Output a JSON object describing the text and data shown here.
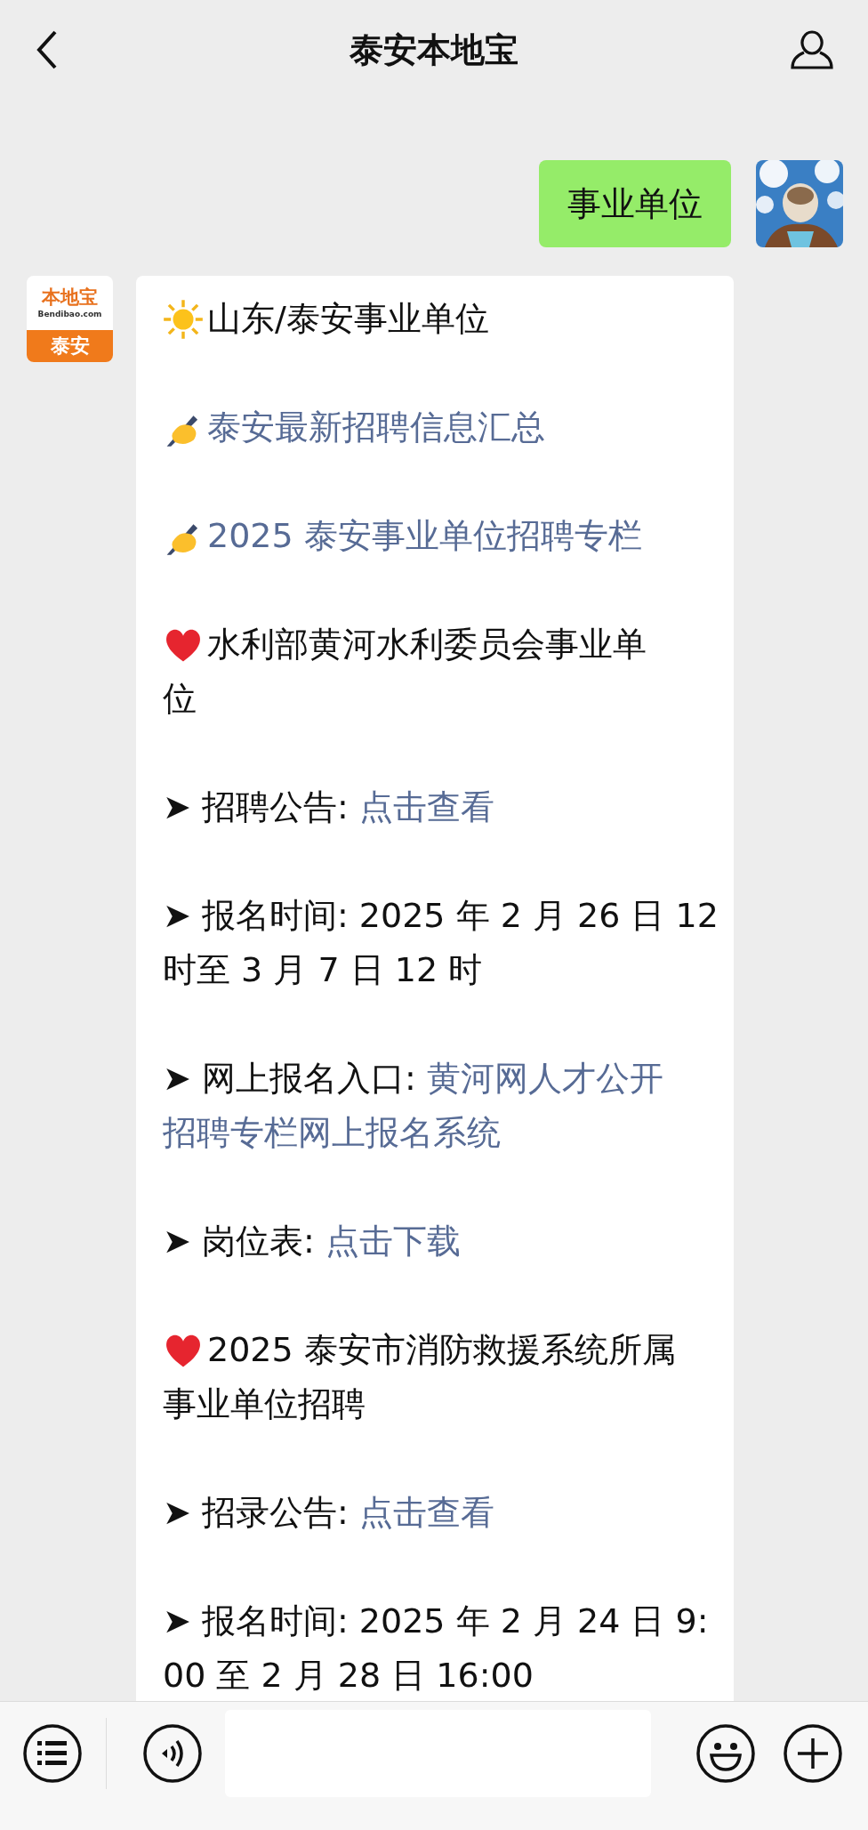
{
  "header": {
    "title": "泰安本地宝"
  },
  "sent": {
    "text": "事业单位"
  },
  "official": {
    "logo": {
      "top": "本地宝",
      "domain": "Bendibao.com",
      "city": "泰安"
    }
  },
  "message": {
    "paragraphs": [
      {
        "kind": "sun",
        "lines": [
          [
            {
              "text": "山东/泰安事业单位",
              "link": false
            }
          ]
        ]
      },
      {
        "kind": "pen",
        "lines": [
          [
            {
              "text": "泰安最新招聘信息汇总",
              "link": true
            }
          ]
        ]
      },
      {
        "kind": "pen",
        "lines": [
          [
            {
              "text": "2025 泰安事业单位招聘专栏",
              "link": true
            }
          ]
        ]
      },
      {
        "kind": "heart",
        "lines": [
          [
            {
              "text": "水利部黄河水利委员会事业单",
              "link": false
            }
          ],
          [
            {
              "text": "位",
              "link": false
            }
          ]
        ]
      },
      {
        "kind": "plain",
        "lines": [
          [
            {
              "text": "➤ 招聘公告: ",
              "link": false
            },
            {
              "text": "点击查看",
              "link": true
            }
          ]
        ]
      },
      {
        "kind": "plain",
        "lines": [
          [
            {
              "text": "➤ 报名时间: 2025 年 2 月 26 日 12",
              "link": false
            }
          ],
          [
            {
              "text": "时至 3 月 7 日 12 时",
              "link": false
            }
          ]
        ]
      },
      {
        "kind": "plain",
        "lines": [
          [
            {
              "text": "➤ 网上报名入口: ",
              "link": false
            },
            {
              "text": "黄河网人才公开",
              "link": true
            }
          ],
          [
            {
              "text": "招聘专栏网上报名系统",
              "link": true
            }
          ]
        ]
      },
      {
        "kind": "plain",
        "lines": [
          [
            {
              "text": "➤ 岗位表: ",
              "link": false
            },
            {
              "text": "点击下载",
              "link": true
            }
          ]
        ]
      },
      {
        "kind": "heart",
        "lines": [
          [
            {
              "text": "2025 泰安市消防救援系统所属",
              "link": false
            }
          ],
          [
            {
              "text": "事业单位招聘",
              "link": false
            }
          ]
        ]
      },
      {
        "kind": "plain",
        "lines": [
          [
            {
              "text": "➤ 招录公告: ",
              "link": false
            },
            {
              "text": "点击查看",
              "link": true
            }
          ]
        ]
      },
      {
        "kind": "plain",
        "lines": [
          [
            {
              "text": "➤ 报名时间: 2025 年 2 月 24 日 9:",
              "link": false
            }
          ],
          [
            {
              "text": "00 至 2 月 28 日 16:00",
              "link": false
            }
          ]
        ]
      }
    ]
  }
}
